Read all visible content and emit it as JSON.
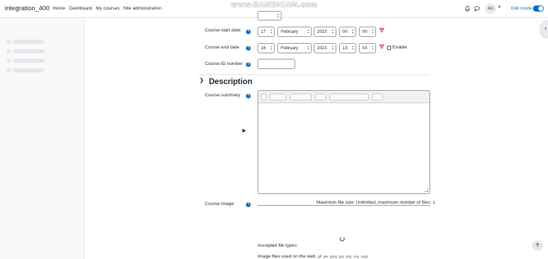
{
  "site": {
    "name": "integration_400"
  },
  "nav": {
    "links": [
      "Home",
      "Dashboard",
      "My courses",
      "Site administration"
    ],
    "user_initials": "AU",
    "edit_mode_label": "Edit mode",
    "edit_mode_on": true
  },
  "watermark": "www.BANDICAM.com",
  "form": {
    "start_date": {
      "label": "Course start date",
      "day": "17",
      "month": "February",
      "year": "2023",
      "hour": "00",
      "minute": "00"
    },
    "end_date": {
      "label": "Course end date",
      "day": "16",
      "month": "February",
      "year": "2023",
      "hour": "13",
      "minute": "03",
      "enable_label": "Enable",
      "enabled": false
    },
    "id_number": {
      "label": "Course ID number",
      "value": ""
    }
  },
  "description": {
    "title": "Description",
    "summary_label": "Course summary",
    "image_label": "Course image",
    "max_file_info": "Maximum file size: Unlimited, maximum number of files: 1",
    "accepted_label": "Accepted file types:",
    "accepted_desc": "Image files used on the web",
    "accepted_ext": ".gif .jpe .jpeg .jpg .png .svg .svgz"
  },
  "help_button": "?",
  "icons": {
    "bell": "bell-icon",
    "chat": "chat-icon",
    "calendar": "calendar-icon",
    "help": "help-icon"
  },
  "colors": {
    "primary": "#0f6cbf",
    "drawer": "#f8f9fa"
  }
}
